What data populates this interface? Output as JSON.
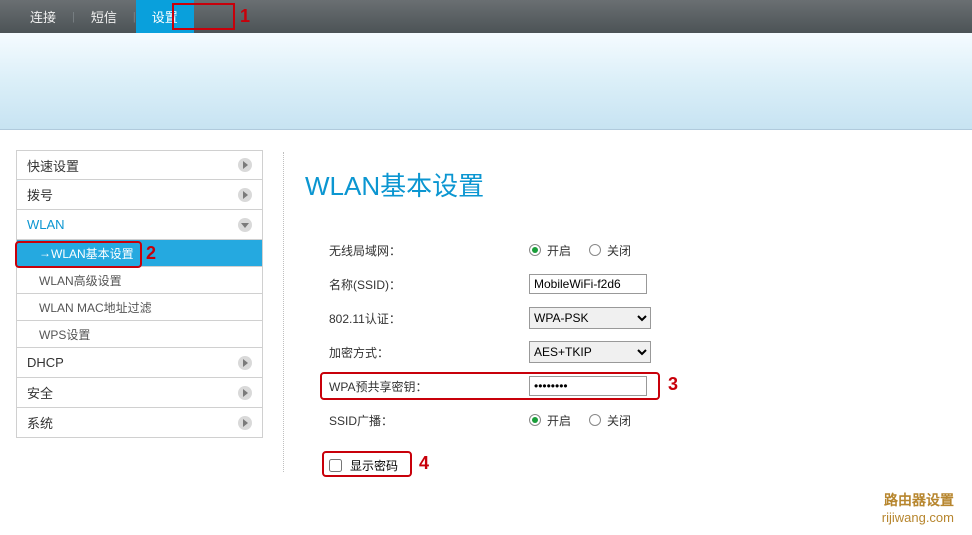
{
  "nav": {
    "items": [
      "连接",
      "短信",
      "设置"
    ],
    "active_index": 2
  },
  "annotations": {
    "n1": "1",
    "n2": "2",
    "n3": "3",
    "n4": "4"
  },
  "sidebar": {
    "cats": [
      {
        "label": "快速设置"
      },
      {
        "label": "拨号"
      },
      {
        "label": "WLAN",
        "open": true,
        "items": [
          "WLAN基本设置",
          "WLAN高级设置",
          "WLAN MAC地址过滤",
          "WPS设置"
        ],
        "selected_index": 0
      },
      {
        "label": "DHCP"
      },
      {
        "label": "安全"
      },
      {
        "label": "系统"
      }
    ]
  },
  "page": {
    "title": "WLAN基本设置",
    "labels": {
      "wlan_enable": "无线局域网：",
      "ssid": "名称(SSID)：",
      "auth": "802.11认证：",
      "encrypt": "加密方式：",
      "psk": "WPA预共享密钥：",
      "broadcast": "SSID广播：",
      "showpw": "显示密码"
    },
    "radio": {
      "on": "开启",
      "off": "关闭"
    },
    "values": {
      "wlan_enable": "on",
      "ssid": "MobileWiFi-f2d6",
      "auth": "WPA-PSK",
      "encrypt": "AES+TKIP",
      "psk": "********",
      "broadcast": "on",
      "showpw": false
    }
  },
  "watermark": {
    "line1": "路由器设置",
    "line2": "rijiwang.com"
  }
}
